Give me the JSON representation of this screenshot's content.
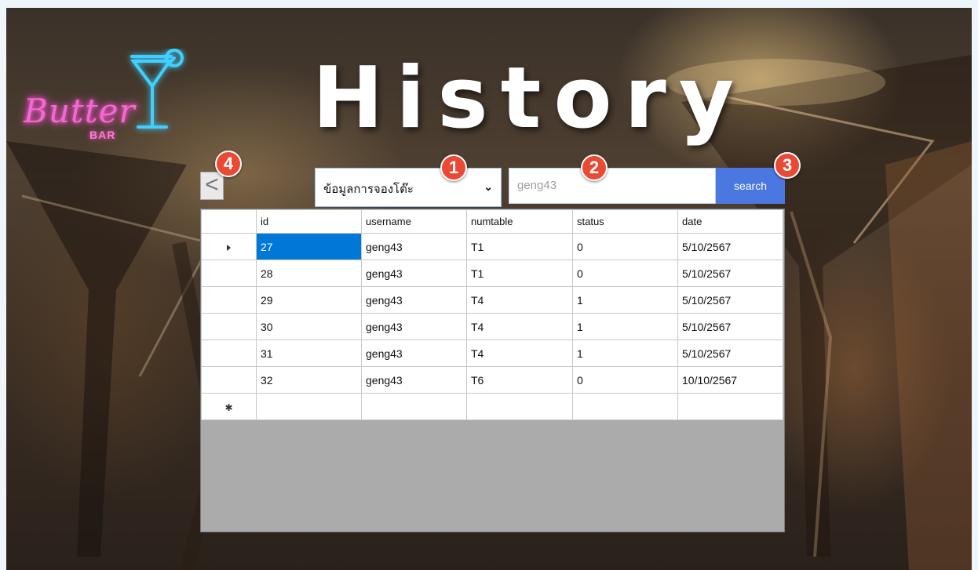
{
  "header": {
    "title": "History",
    "logo_text": "Butter",
    "logo_sub": "BAR"
  },
  "toolbar": {
    "back_label": "<",
    "select_value": "ข้อมูลการจองโต๊ะ",
    "search_value": "geng43",
    "search_label": "search"
  },
  "markers": [
    "1",
    "2",
    "3",
    "4"
  ],
  "grid": {
    "columns": [
      "id",
      "username",
      "numtable",
      "status",
      "date"
    ],
    "rows": [
      [
        "27",
        "geng43",
        "T1",
        "0",
        "5/10/2567"
      ],
      [
        "28",
        "geng43",
        "T1",
        "0",
        "5/10/2567"
      ],
      [
        "29",
        "geng43",
        "T4",
        "1",
        "5/10/2567"
      ],
      [
        "30",
        "geng43",
        "T4",
        "1",
        "5/10/2567"
      ],
      [
        "31",
        "geng43",
        "T4",
        "1",
        "5/10/2567"
      ],
      [
        "32",
        "geng43",
        "T6",
        "0",
        "10/10/2567"
      ]
    ],
    "selected_row": 0
  },
  "colors": {
    "search_button": "#4a78e0",
    "marker": "#ea4a35",
    "selection": "#0078d7",
    "logo_neon": "#f06bd1"
  }
}
